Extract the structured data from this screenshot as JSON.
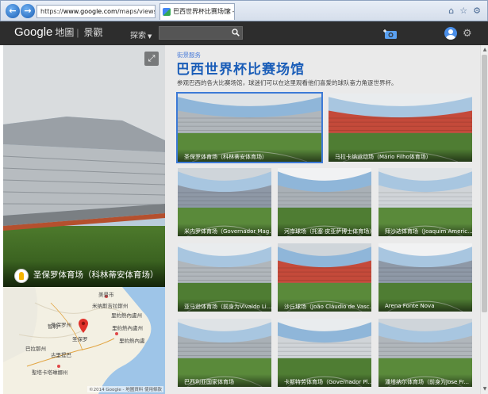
{
  "browser": {
    "url_prefix": "https://",
    "url_host": "www.google.com",
    "url_rest": "/maps/views/stree",
    "tab_title": "巴西世界杯比赛场馆 - 街景 ...",
    "back_label": "←",
    "forward_label": "→",
    "close_label": "×",
    "home_glyph": "⌂",
    "star_glyph": "☆",
    "settings_glyph": "⚙"
  },
  "header": {
    "logo": "Google",
    "product": "地圖",
    "separator": "|",
    "section": "景觀",
    "search_label": "探索",
    "search_caret": "▼",
    "search_placeholder": "",
    "gear_glyph": "⚙"
  },
  "left_panel": {
    "expand_glyph": "⤢",
    "pano_caption": "圣保罗体育场（科林蒂安体育场）",
    "map": {
      "labels": [
        {
          "id": "label-1",
          "text": "美景市"
        },
        {
          "id": "label-2",
          "text": "米纳斯吉拉斯州"
        },
        {
          "id": "label-3",
          "text": "圣保罗州"
        },
        {
          "id": "label-4",
          "text": "圣保罗"
        },
        {
          "id": "label-5",
          "text": "里約熱內盧州"
        },
        {
          "id": "label-6",
          "text": "里約熱內盧"
        },
        {
          "id": "label-7",
          "text": "巴拉那州"
        },
        {
          "id": "label-8",
          "text": "古里提巴"
        },
        {
          "id": "label-9",
          "text": "聖塔卡塔琳娜州"
        },
        {
          "id": "label-10",
          "text": "智利"
        },
        {
          "id": "label-11",
          "text": "里約熱內盧州"
        }
      ],
      "credit": "©2014 Google - 地圖資料  使用條款"
    }
  },
  "content": {
    "breadcrumb": "街景服务",
    "title": "巴西世界杯比赛场馆",
    "description": "参观巴西的各大比赛场馆，球迷们可以在这里观看他们喜爱的球队奋力角逐世界杯。",
    "scroll_up": "▲",
    "scroll_down": "▼",
    "tiles": [
      {
        "label": "圣保罗体育场（科林蒂安体育场）",
        "selected": true
      },
      {
        "label": "马拉卡纳运动场（Mário Filho体育场）",
        "selected": false
      },
      {
        "label": "米内罗体育场（Governador Mag...",
        "selected": false
      },
      {
        "label": "河岸球场（托塞·皮亚萨博士体育场）",
        "selected": false
      },
      {
        "label": "拜沙达体育场（Joaquim Americ...",
        "selected": false
      },
      {
        "label": "亚马逊体育场（前身为Vivaldo Li...",
        "selected": false
      },
      {
        "label": "沙丘球场（João Cláudio de Vasc...",
        "selected": false
      },
      {
        "label": "Arena Fonte Nova",
        "selected": false
      },
      {
        "label": "巴西利亚国家体育场",
        "selected": false
      },
      {
        "label": "卡斯特劳体育场（Governador Pl...",
        "selected": false
      },
      {
        "label": "潘塔纳尔体育场（前身为Jose Fr...",
        "selected": false
      }
    ]
  }
}
